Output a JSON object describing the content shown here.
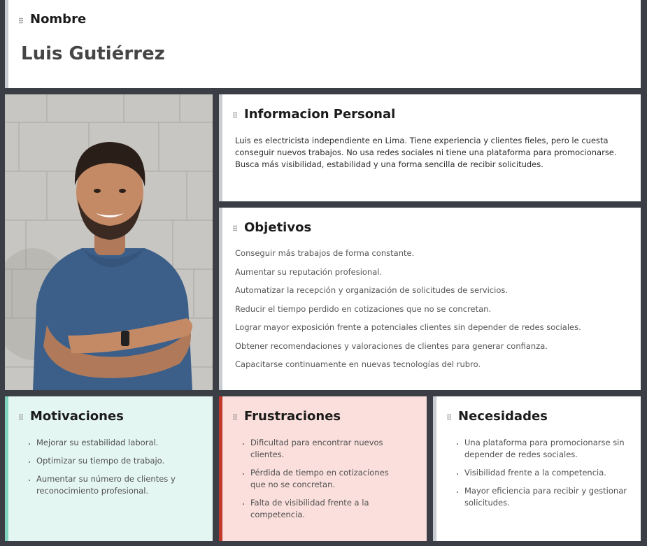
{
  "nombre": {
    "title": "Nombre",
    "value": "Luis Gutiérrez"
  },
  "photo": {
    "alt": "Foto de Luis Gutiérrez"
  },
  "informacion": {
    "title": "Informacion Personal",
    "text": "Luis es electricista independiente en Lima. Tiene experiencia y clientes fieles, pero le cuesta conseguir nuevos trabajos. No usa redes sociales ni tiene una plataforma para promocionarse. Busca más visibilidad, estabilidad y una forma sencilla de recibir solicitudes."
  },
  "objetivos": {
    "title": "Objetivos",
    "items": [
      "Conseguir más trabajos de forma constante.",
      "Aumentar su reputación profesional.",
      "Automatizar la recepción y organización de solicitudes de servicios.",
      "Reducir el tiempo perdido en cotizaciones que no se concretan.",
      "Lograr mayor exposición frente a potenciales clientes sin depender de redes sociales.",
      "Obtener recomendaciones y valoraciones de clientes para generar confianza.",
      "Capacitarse continuamente en nuevas tecnologías del rubro."
    ]
  },
  "motivaciones": {
    "title": "Motivaciones",
    "items": [
      "Mejorar su estabilidad laboral.",
      "Optimizar su tiempo de trabajo.",
      "Aumentar su número de clientes y reconocimiento profesional."
    ]
  },
  "frustraciones": {
    "title": "Frustraciones",
    "items": [
      "Dificultad para encontrar nuevos clientes.",
      "Pérdida de tiempo en cotizaciones que no se concretan.",
      "Falta de visibilidad frente a la competencia."
    ]
  },
  "necesidades": {
    "title": "Necesidades",
    "items": [
      "Una plataforma para promocionarse sin depender de redes sociales.",
      "Visibilidad frente a la competencia.",
      "Mayor eficiencia para recibir y gestionar solicitudes."
    ]
  },
  "colors": {
    "background": "#3b3f45",
    "motivaciones_bg": "#e4f6f1",
    "motivaciones_accent": "#7fd3c0",
    "frustraciones_bg": "#fadfdc",
    "frustraciones_accent": "#c0392b",
    "neutral_accent": "#c9ccd1"
  }
}
